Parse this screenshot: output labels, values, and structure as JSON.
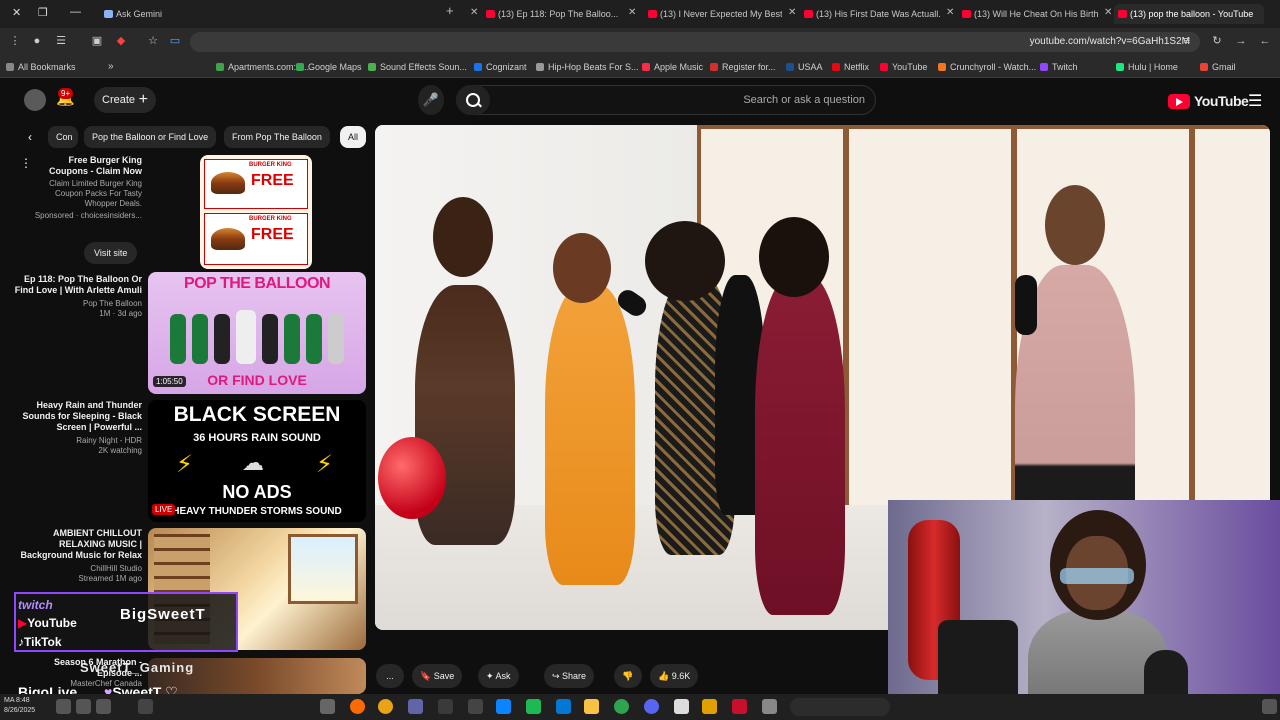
{
  "browser": {
    "tabs": [
      {
        "label": "(13) pop the balloon - YouTube"
      },
      {
        "label": "(13) Will He Cheat On His Birth..."
      },
      {
        "label": "(13) His First Date Was Actuall..."
      },
      {
        "label": "(13) I Never Expected My Best..."
      },
      {
        "label": "(13) Ep 118: Pop The Balloo..."
      },
      {
        "label": "Ask Gemini"
      }
    ],
    "url": "youtube.com/watch?v=6GaHh1S2M",
    "bookmarks": [
      {
        "label": "All Bookmarks",
        "color": "#888888"
      },
      {
        "label": "Apartments.com: A...",
        "color": "#3fa34d"
      },
      {
        "label": "Google Maps",
        "color": "#34a853"
      },
      {
        "label": "Sound Effects Soun...",
        "color": "#4caf50"
      },
      {
        "label": "Cognizant",
        "color": "#1a73e8"
      },
      {
        "label": "Hip-Hop Beats For S...",
        "color": "#999999"
      },
      {
        "label": "Apple Music",
        "color": "#fa2d48"
      },
      {
        "label": "Register for...",
        "color": "#d32f2f"
      },
      {
        "label": "USAA",
        "color": "#1f4e8c"
      },
      {
        "label": "Netflix",
        "color": "#e50914"
      },
      {
        "label": "YouTube",
        "color": "#ff0033"
      },
      {
        "label": "Crunchyroll - Watch...",
        "color": "#f47521"
      },
      {
        "label": "Twitch",
        "color": "#9146ff"
      },
      {
        "label": "Hulu | Home",
        "color": "#1ce783"
      },
      {
        "label": "Gmail",
        "color": "#ea4335"
      }
    ]
  },
  "masthead": {
    "logo_text": "YouTube",
    "search_placeholder": "Search or ask a question",
    "create_label": "Create",
    "notif_count": "9+"
  },
  "chips": [
    {
      "label": "All",
      "selected": true
    },
    {
      "label": "From Pop The Balloon",
      "selected": false
    },
    {
      "label": "Pop the Balloon or Find Love",
      "selected": false
    },
    {
      "label": "Con",
      "selected": false
    }
  ],
  "recommendations": [
    {
      "title": "Free Burger King Coupons - Claim Now",
      "desc": "Claim Limited Burger King Coupon Packs For Tasty Whopper Deals.",
      "sponsored": "Sponsored · choicesinsiders...",
      "cta": "Visit site",
      "thumb_text": "FREE",
      "thumb_sub": "BURGER KING"
    },
    {
      "title": "Ep 118: Pop The Balloon Or Find Love | With Arlette Amuli",
      "channel": "Pop The Balloon",
      "meta": "1M · 3d ago",
      "duration": "1:05:50",
      "thumb_top": "POP THE BALLOON",
      "thumb_bottom": "OR FIND LOVE"
    },
    {
      "title": "Heavy Rain and Thunder Sounds for Sleeping - Black Screen | Powerful ...",
      "channel": "Rainy Night - HDR",
      "meta": "2K watching",
      "badge": "LIVE",
      "thumb_l1": "BLACK SCREEN",
      "thumb_l2": "36 HOURS RAIN SOUND",
      "thumb_l3": "NO ADS",
      "thumb_l4": "HEAVY THUNDER STORMS SOUND"
    },
    {
      "title": "AMBIENT CHILLOUT RELAXING MUSIC | Background Music for Relax",
      "channel": "ChillHill Studio",
      "meta": "Streamed 1M ago"
    },
    {
      "title": "Season 6 Marathon - Episode ...",
      "channel": "MasterChef Canada"
    }
  ],
  "actions": {
    "likes": "9.6K",
    "share": "Share",
    "ask": "Ask",
    "save": "Save",
    "more": "..."
  },
  "overlay": {
    "twitch": "twitch",
    "youtube": "YouTube",
    "tiktok": "TikTok",
    "bigo": "BigoLive",
    "name": "BigSweetT",
    "gamer_tag": "SweetT_Gaming",
    "bottom_tag": "SweetT"
  },
  "taskbar": {
    "time": "MA 8:48",
    "date": "8/26/2025"
  },
  "colors": {
    "yt_red": "#ff0033",
    "twitch_purple": "#9146ff"
  }
}
